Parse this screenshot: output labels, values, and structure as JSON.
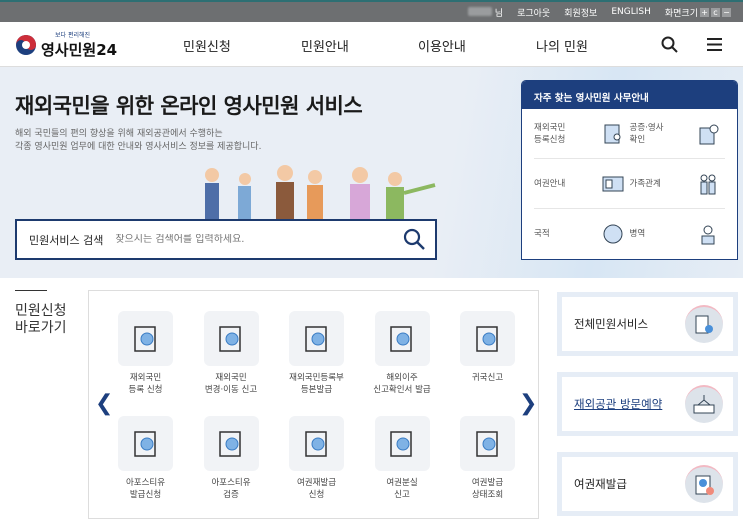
{
  "topbar": {
    "user_suffix": "님",
    "logout": "로그아웃",
    "member_info": "회원정보",
    "english": "ENGLISH",
    "font_size": "화면크기",
    "font_plus": "+",
    "font_reset": "c",
    "font_minus": "−"
  },
  "header": {
    "logo_sub": "보다 편리해진",
    "logo_main": "영사민원24",
    "nav": [
      "민원신청",
      "민원안내",
      "이용안내",
      "나의 민원"
    ]
  },
  "hero": {
    "title": "재외국민을 위한 온라인 영사민원 서비스",
    "desc_line1": "해외 국민들의 편의 향상을 위해 재외공관에서 수행하는",
    "desc_line2": "각종 영사민원 업무에 대한 안내와 영사서비스 정보를 제공합니다.",
    "search_label": "민원서비스 검색",
    "search_placeholder": "찾으시는 검색어를 입력하세요."
  },
  "panel": {
    "title": "자주 찾는 영사민원 사무안내",
    "items": [
      [
        "재외국민",
        "등록신청"
      ],
      [
        "공증·영사",
        "확인"
      ],
      [
        "여권안내",
        ""
      ],
      [
        "가족관계",
        ""
      ],
      [
        "국적",
        ""
      ],
      [
        "병역",
        ""
      ]
    ]
  },
  "shortcut": {
    "title_line1": "민원신청",
    "title_line2": "바로가기",
    "items": [
      [
        "재외국민",
        "등록 신청"
      ],
      [
        "재외국민",
        "변경·이동 신고"
      ],
      [
        "재외국민등록부",
        "등본발급"
      ],
      [
        "해외이주",
        "신고확인서 발급"
      ],
      [
        "귀국신고",
        ""
      ],
      [
        "아포스티유",
        "발급신청"
      ],
      [
        "아포스티유",
        "검증"
      ],
      [
        "여권재발급",
        "신청"
      ],
      [
        "여권분실",
        "신고"
      ],
      [
        "여권발급",
        "상태조회"
      ]
    ]
  },
  "cards": [
    "전체민원서비스",
    "재외공관 방문예약",
    "여권재발급"
  ],
  "colors": {
    "navy": "#1d3f7e",
    "accent": "#4a90d9"
  }
}
